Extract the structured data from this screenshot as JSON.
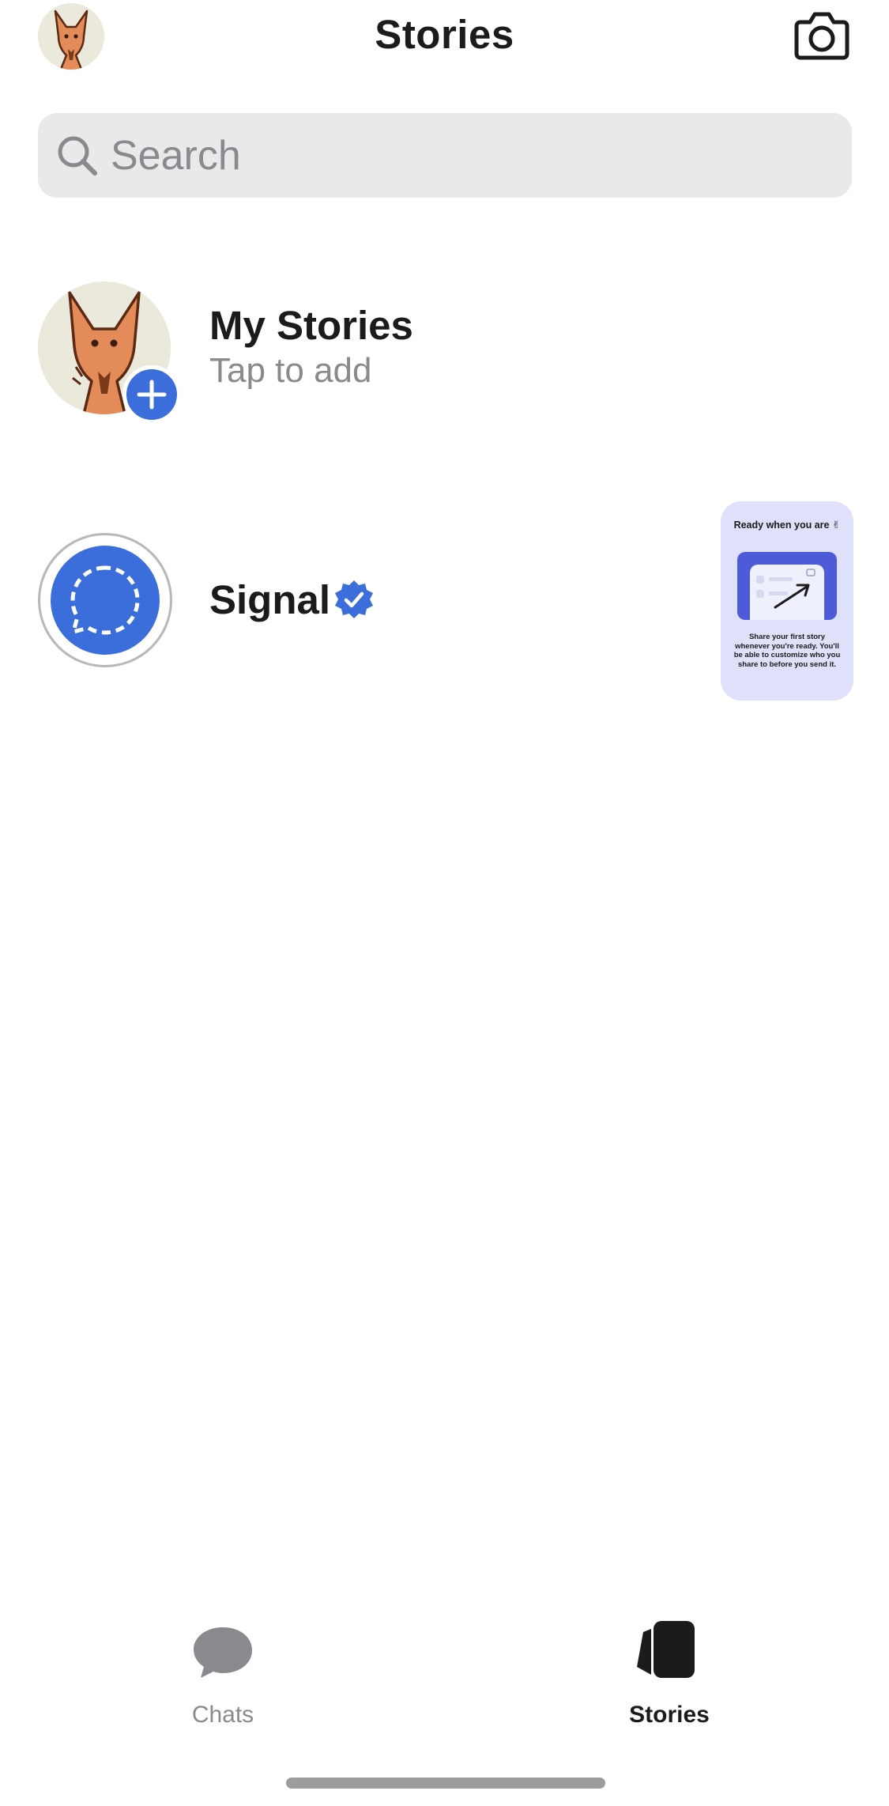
{
  "header": {
    "title": "Stories",
    "camera_icon": "camera-icon",
    "avatar_icon": "fox-avatar"
  },
  "search": {
    "placeholder": "Search",
    "value": ""
  },
  "my_stories": {
    "title": "My Stories",
    "subtitle": "Tap to add",
    "badge_icon": "plus-icon"
  },
  "signal_story": {
    "name": "Signal",
    "verified_icon": "verified-badge-icon",
    "thumbnail": {
      "title": "Ready when you are",
      "emoji": "✌",
      "body": "Share your first story whenever you're ready. You'll be able to customize who you share to before you send it."
    }
  },
  "tabbar": {
    "tabs": [
      {
        "label": "Chats",
        "icon": "chat-bubble-icon",
        "active": false
      },
      {
        "label": "Stories",
        "icon": "stories-icon",
        "active": true
      }
    ]
  },
  "colors": {
    "accent": "#3b6ddb",
    "search_bg": "#e9e9e9",
    "secondary_text": "#8a8a8e",
    "inactive_tab": "#8a8a8e",
    "active_tab": "#1b1b1d"
  }
}
